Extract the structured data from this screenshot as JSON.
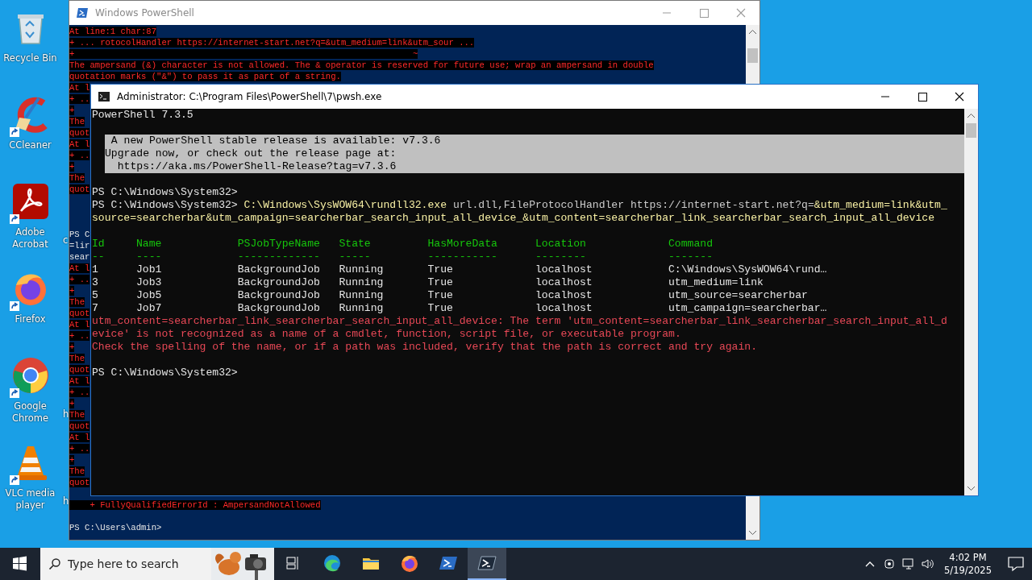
{
  "desktop": {
    "icons": [
      {
        "kind": "recycle",
        "label": "Recycle Bin",
        "shortcut": false
      },
      {
        "kind": "ccleaner",
        "label": "CCleaner",
        "shortcut": true
      },
      {
        "kind": "acrobat",
        "label": "Adobe Acrobat",
        "shortcut": true,
        "next_column_label": "c"
      },
      {
        "kind": "firefox",
        "label": "Firefox",
        "shortcut": true
      },
      {
        "kind": "chrome",
        "label": "Google Chrome",
        "shortcut": true,
        "next_column_label": "h"
      },
      {
        "kind": "vlc",
        "label": "VLC media player",
        "shortcut": true,
        "next_column_label": "h"
      }
    ]
  },
  "back_window": {
    "title": "Windows PowerShell",
    "lines": [
      {
        "kind": "error",
        "text": "At line:1 char:87"
      },
      {
        "kind": "error",
        "text": "+ ... rotocolHandler https://internet-start.net?q=&utm_medium=link&utm_sour ..."
      },
      {
        "kind": "error",
        "text": "+                                                                  ~"
      },
      {
        "kind": "error",
        "text": "The ampersand (&) character is not allowed. The & operator is reserved for future use; wrap an ampersand in double"
      },
      {
        "kind": "error",
        "text": "quotation marks (\"&\") to pass it as part of a string."
      },
      {
        "kind": "error",
        "text": "At l"
      },
      {
        "kind": "error",
        "text": "+ .."
      },
      {
        "kind": "error",
        "text": "+"
      },
      {
        "kind": "error",
        "text": "The"
      },
      {
        "kind": "error",
        "text": "quot"
      },
      {
        "kind": "error",
        "text": "At l"
      },
      {
        "kind": "error",
        "text": "+ .."
      },
      {
        "kind": "error",
        "text": "+"
      },
      {
        "kind": "error",
        "text": "The"
      },
      {
        "kind": "error",
        "text": "quot"
      },
      {
        "kind": "blank"
      },
      {
        "kind": "blank"
      },
      {
        "kind": "blank"
      },
      {
        "kind": "output",
        "text": "PS C"
      },
      {
        "kind": "output",
        "text": "=lir"
      },
      {
        "kind": "output",
        "text": "sear"
      },
      {
        "kind": "error",
        "text": "At l"
      },
      {
        "kind": "error",
        "text": "+ .."
      },
      {
        "kind": "error",
        "text": "+"
      },
      {
        "kind": "error",
        "text": "The"
      },
      {
        "kind": "error",
        "text": "quot"
      },
      {
        "kind": "error",
        "text": "At l"
      },
      {
        "kind": "error",
        "text": "+ .."
      },
      {
        "kind": "error",
        "text": "+"
      },
      {
        "kind": "error",
        "text": "The"
      },
      {
        "kind": "error",
        "text": "quot"
      },
      {
        "kind": "error",
        "text": "At l"
      },
      {
        "kind": "error",
        "text": "+ .."
      },
      {
        "kind": "error",
        "text": "+"
      },
      {
        "kind": "error",
        "text": "The"
      },
      {
        "kind": "error",
        "text": "quot"
      },
      {
        "kind": "error",
        "text": "At l"
      },
      {
        "kind": "error",
        "text": "+ .."
      },
      {
        "kind": "error",
        "text": "+"
      },
      {
        "kind": "error",
        "text": "The"
      },
      {
        "kind": "error",
        "text": "quot"
      },
      {
        "kind": "blank"
      },
      {
        "kind": "error",
        "text": "    + FullyQualifiedErrorId : AmpersandNotAllowed"
      },
      {
        "kind": "blank"
      },
      {
        "kind": "output",
        "text": "PS C:\\Users\\admin>"
      }
    ]
  },
  "front_window": {
    "title": "Administrator: C:\\Program Files\\PowerShell\\7\\pwsh.exe",
    "lines": [
      {
        "kind": "output",
        "text": "PowerShell 7.3.5"
      },
      {
        "kind": "blank"
      },
      {
        "kind": "banner",
        "text": " A new PowerShell stable release is available: v7.3.6"
      },
      {
        "kind": "banner",
        "text": "Upgrade now, or check out the release page at:"
      },
      {
        "kind": "banner",
        "text": "  https://aka.ms/PowerShell-Release?tag=v7.3.6"
      },
      {
        "kind": "blank"
      },
      {
        "kind": "output",
        "text": "PS C:\\Windows\\System32>"
      },
      {
        "kind": "segments",
        "parts": [
          {
            "kind": "prompt",
            "text": "PS C:\\Windows\\System32> "
          },
          {
            "kind": "command",
            "text": "C:\\Windows\\SysWOW64\\rundll32.exe"
          },
          {
            "kind": "argument",
            "text": " url.dll,FileProtocolHandler https://internet-start.net?q="
          },
          {
            "kind": "command",
            "text": "&utm_medium=link&utm_"
          }
        ]
      },
      {
        "kind": "segments",
        "parts": [
          {
            "kind": "command",
            "text": "source=searcherbar&utm_campaign=searcherbar_search_input_all_device_&utm_content=searcherbar_link_searcherbar_search_input_all_device"
          }
        ]
      },
      {
        "kind": "blank"
      },
      {
        "kind": "table",
        "columns": [
          "Id",
          "Name",
          "PSJobTypeName",
          "State",
          "HasMoreData",
          "Location",
          "Command"
        ],
        "rules": [
          "--",
          "----",
          "-------------",
          "-----",
          "-----------",
          "--------",
          "-------"
        ],
        "rows": [
          [
            "1",
            "Job1",
            "BackgroundJob",
            "Running",
            "True",
            "localhost",
            "C:\\Windows\\SysWOW64\\rund…"
          ],
          [
            "3",
            "Job3",
            "BackgroundJob",
            "Running",
            "True",
            "localhost",
            "utm_medium=link"
          ],
          [
            "5",
            "Job5",
            "BackgroundJob",
            "Running",
            "True",
            "localhost",
            "utm_source=searcherbar"
          ],
          [
            "7",
            "Job7",
            "BackgroundJob",
            "Running",
            "True",
            "localhost",
            "utm_campaign=searcherbar…"
          ]
        ]
      },
      {
        "kind": "error",
        "text": "utm_content=searcherbar_link_searcherbar_search_input_all_device: The term 'utm_content=searcherbar_link_searcherbar_search_input_all_d"
      },
      {
        "kind": "error",
        "text": "evice' is not recognized as a name of a cmdlet, function, script file, or executable program."
      },
      {
        "kind": "error",
        "text": "Check the spelling of the name, or if a path was included, verify that the path is correct and try again."
      },
      {
        "kind": "blank"
      },
      {
        "kind": "output",
        "text": "PS C:\\Windows\\System32>"
      }
    ]
  },
  "taskbar": {
    "search": {
      "placeholder": "Type here to search"
    },
    "apps": [
      {
        "kind": "taskview",
        "selected": false
      },
      {
        "kind": "edge",
        "selected": false
      },
      {
        "kind": "explorer",
        "selected": false
      },
      {
        "kind": "firefox",
        "selected": false
      },
      {
        "kind": "powershell",
        "selected": false
      },
      {
        "kind": "pwsh",
        "selected": true
      }
    ],
    "clock": {
      "time": "4:02 PM",
      "date": "5/19/2025"
    }
  }
}
